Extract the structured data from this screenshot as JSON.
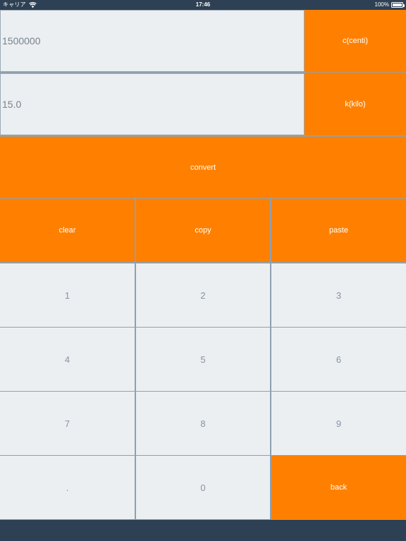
{
  "status_bar": {
    "carrier": "キャリア",
    "wifi_icon": "wifi-icon",
    "time": "17:46",
    "battery_percent": "100%",
    "battery_icon": "battery-icon"
  },
  "colors": {
    "accent_orange": "#ff8000",
    "light_button": "#eceff1",
    "dark_bar": "#2e4053",
    "grid_line": "#8fa0b0",
    "muted_text": "#8494a4",
    "field_text": "#76838f"
  },
  "converter": {
    "rows": [
      {
        "value": "1500000",
        "placeholder": "",
        "unit_label": "c(centi)"
      },
      {
        "value": "15.0",
        "placeholder": "",
        "unit_label": "k(kilo)"
      }
    ],
    "convert_label": "convert"
  },
  "actions": {
    "clear_label": "clear",
    "copy_label": "copy",
    "paste_label": "paste"
  },
  "keypad": {
    "rows": [
      [
        {
          "label": "1"
        },
        {
          "label": "2"
        },
        {
          "label": "3"
        }
      ],
      [
        {
          "label": "4"
        },
        {
          "label": "5"
        },
        {
          "label": "6"
        }
      ],
      [
        {
          "label": "7"
        },
        {
          "label": "8"
        },
        {
          "label": "9"
        }
      ],
      [
        {
          "label": "."
        },
        {
          "label": "0"
        },
        {
          "label": "back"
        }
      ]
    ]
  }
}
